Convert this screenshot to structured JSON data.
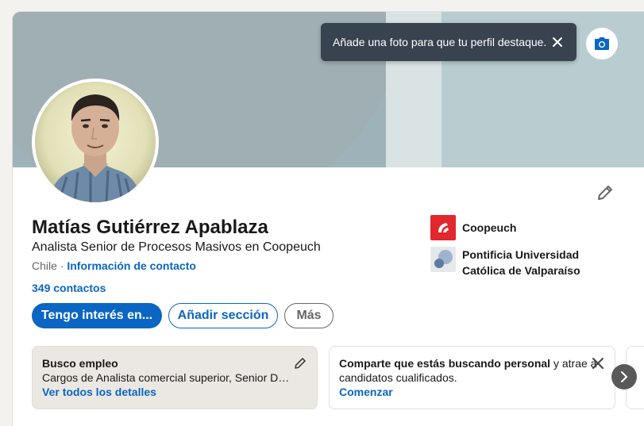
{
  "toast": {
    "message": "Añade una foto para que tu perfil destaque."
  },
  "profile": {
    "name": "Matías Gutiérrez Apablaza",
    "headline": "Analista Senior de Procesos Masivos en Coopeuch",
    "location": "Chile",
    "separator": " · ",
    "contact_info_link": "Información de contacto",
    "connections": "349 contactos"
  },
  "organizations": [
    {
      "name": "Coopeuch",
      "logo": "coopeuch-logo"
    },
    {
      "name_line1": "Pontificia Universidad",
      "name_line2": "Católica de Valparaíso",
      "logo": "pucv-logo"
    }
  ],
  "actions": {
    "open_to": "Tengo interés en...",
    "add_section": "Añadir sección",
    "more": "Más"
  },
  "open_to_work": {
    "title": "Busco empleo",
    "roles": "Cargos de Analista comercial superior, Senior Dat...",
    "link": "Ver todos los detalles"
  },
  "hiring": {
    "text_bold": "Comparte que estás buscando personal",
    "text_rest": " y atrae a",
    "text_line2": "candidatos cualificados.",
    "link": "Comenzar"
  },
  "colors": {
    "brand_blue": "#0a66c2",
    "toast_bg": "#38434f",
    "coopeuch_red": "#e0282e"
  },
  "icons": [
    "close-icon",
    "camera-icon",
    "pencil-icon",
    "chevron-right-icon"
  ]
}
